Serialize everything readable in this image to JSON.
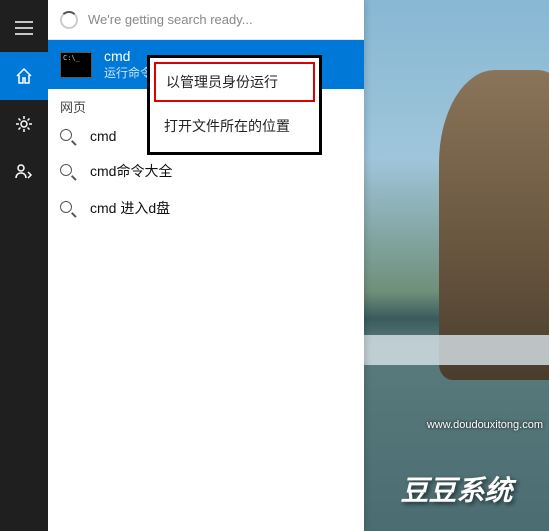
{
  "search": {
    "placeholder_text": "We're getting search ready..."
  },
  "best_match": {
    "title": "cmd",
    "subtitle": "运行命令"
  },
  "section_web": "网页",
  "web_results": [
    {
      "label": "cmd"
    },
    {
      "label": "cmd命令大全"
    },
    {
      "label": "cmd 进入d盘"
    }
  ],
  "context_menu": {
    "run_admin": "以管理员身份运行",
    "open_location": "打开文件所在的位置"
  },
  "desktop": {
    "watermark": "www.doudouxitong.com",
    "brand": "豆豆系统"
  }
}
